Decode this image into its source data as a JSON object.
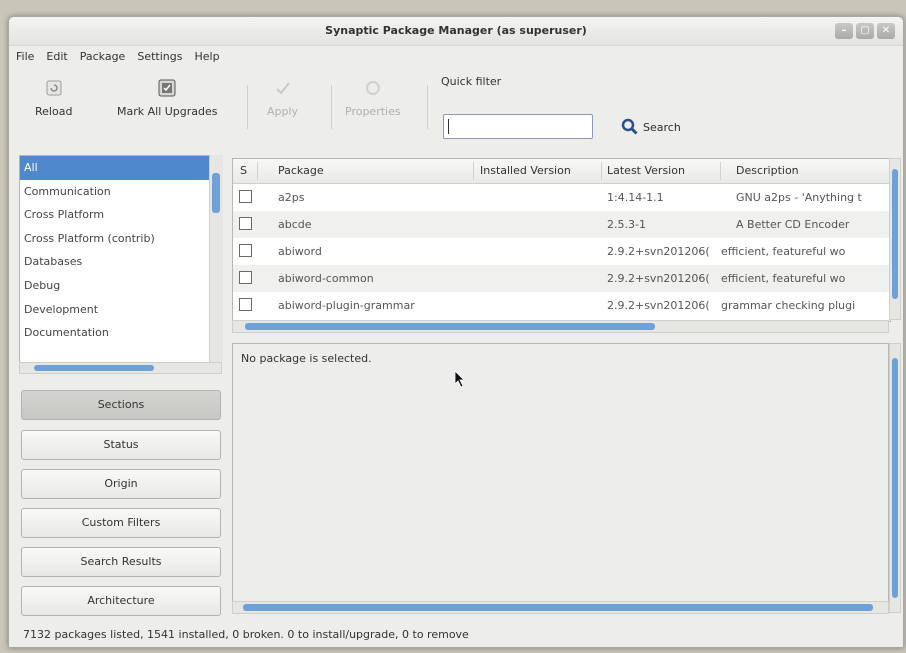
{
  "window": {
    "title": "Synaptic Package Manager  (as superuser)"
  },
  "menu": [
    "File",
    "Edit",
    "Package",
    "Settings",
    "Help"
  ],
  "toolbar": {
    "reload_label": "Reload",
    "mark_all_label": "Mark All Upgrades",
    "apply_label": "Apply",
    "properties_label": "Properties",
    "quick_filter_label": "Quick filter",
    "quick_filter_value": "",
    "search_label": "Search"
  },
  "categories": {
    "selected": "All",
    "items": [
      "All",
      "Communication",
      "Cross Platform",
      "Cross Platform (contrib)",
      "Databases",
      "Debug",
      "Development",
      "Documentation"
    ]
  },
  "side_buttons": [
    "Sections",
    "Status",
    "Origin",
    "Custom Filters",
    "Search Results",
    "Architecture"
  ],
  "table": {
    "columns": [
      "S",
      "Package",
      "Installed Version",
      "Latest Version",
      "Description"
    ],
    "rows": [
      {
        "package": "a2ps",
        "installed": "",
        "latest": "1:4.14-1.1",
        "description": "GNU a2ps - 'Anything t"
      },
      {
        "package": "abcde",
        "installed": "",
        "latest": "2.5.3-1",
        "description": "A Better CD Encoder"
      },
      {
        "package": "abiword",
        "installed": "",
        "latest": "2.9.2+svn201206(",
        "description": "efficient, featureful wo"
      },
      {
        "package": "abiword-common",
        "installed": "",
        "latest": "2.9.2+svn201206(",
        "description": "efficient, featureful wo"
      },
      {
        "package": "abiword-plugin-grammar",
        "installed": "",
        "latest": "2.9.2+svn201206(",
        "description": "grammar checking plugi"
      }
    ]
  },
  "details": {
    "message": "No package is selected."
  },
  "status": {
    "text": "7132 packages listed, 1541 installed, 0 broken. 0 to install/upgrade, 0 to remove"
  },
  "colors": {
    "selection": "#4f88cc",
    "scrollbar": "#6fa0d8"
  }
}
